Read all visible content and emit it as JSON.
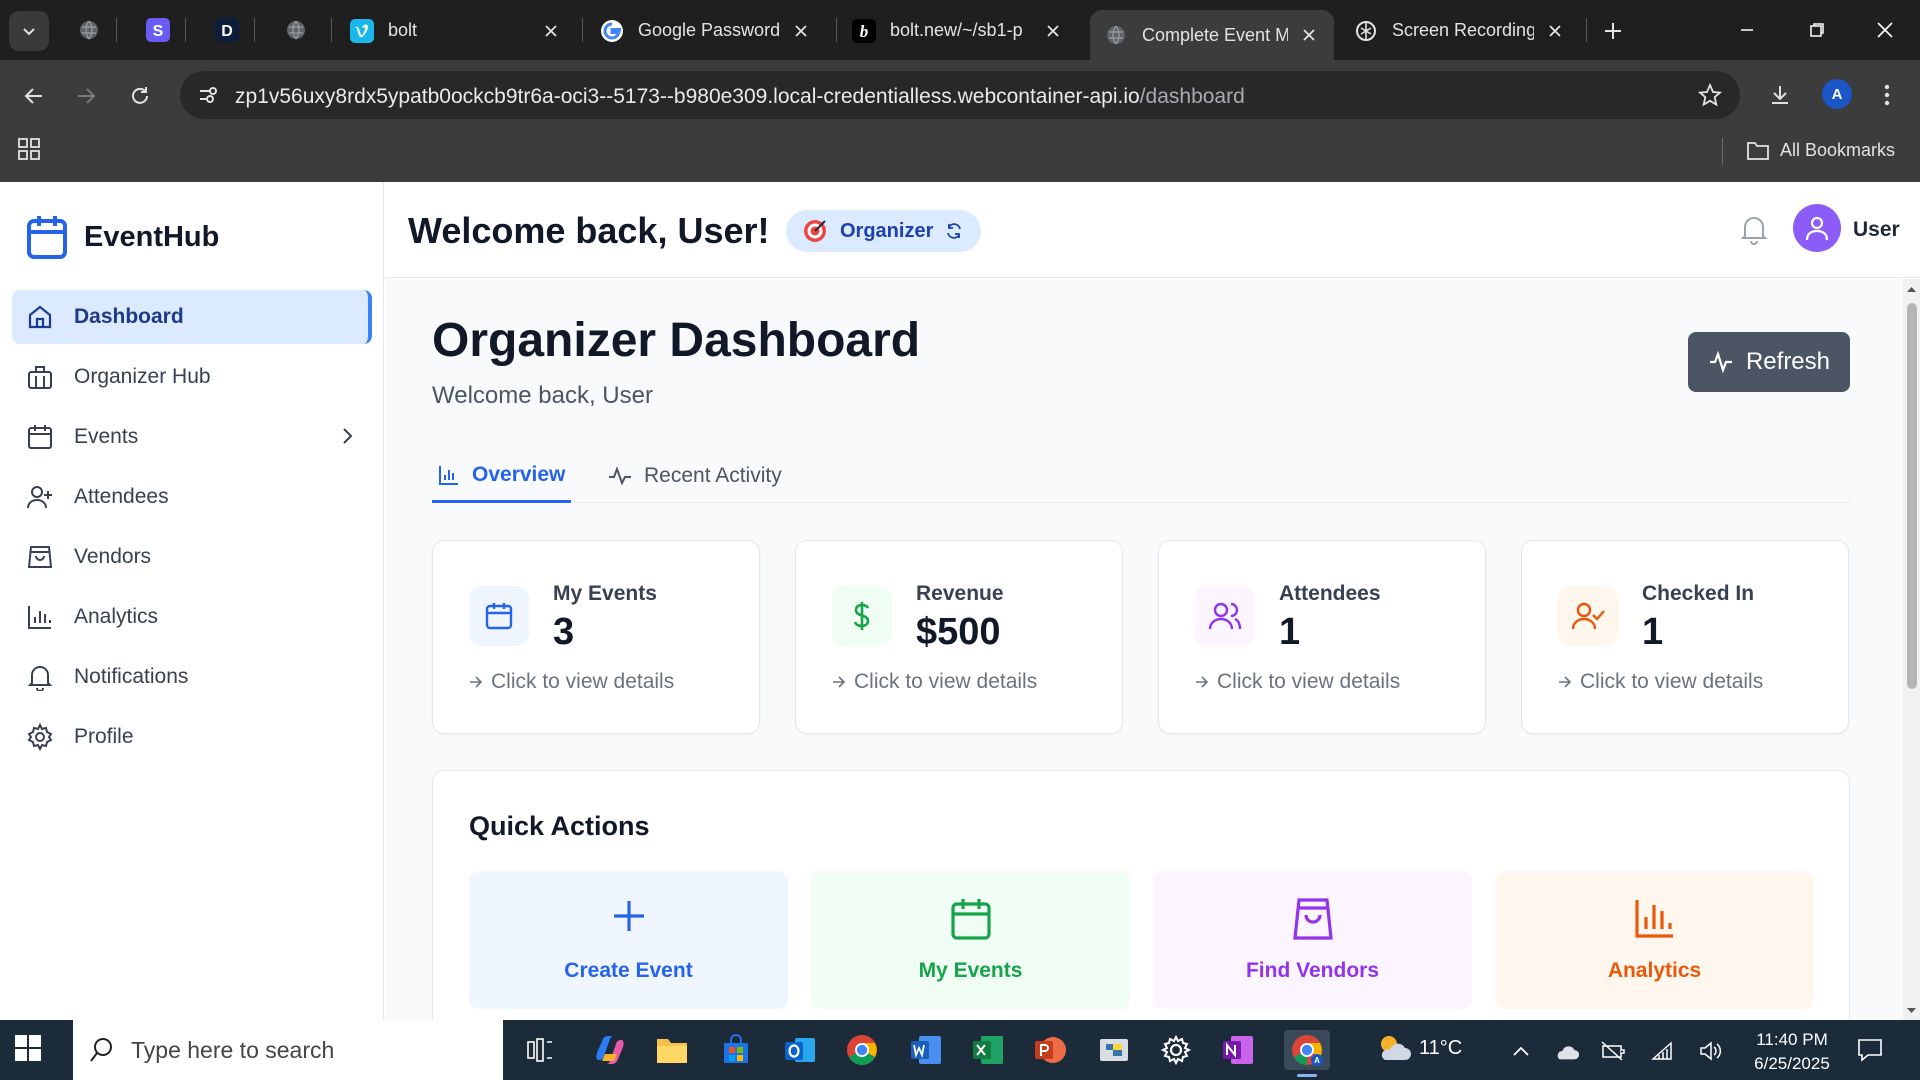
{
  "browser": {
    "tabs": [
      {
        "title": "bolt",
        "favicon": "bolt-favicon"
      },
      {
        "title": "Google Password M",
        "favicon": "google-favicon"
      },
      {
        "title": "bolt.new/~/sb1-p",
        "favicon": "bolt-new-favicon"
      },
      {
        "title": "Complete Event M",
        "favicon": "globe-favicon",
        "active": true
      },
      {
        "title": "Screen Recording",
        "favicon": "openai-favicon"
      }
    ],
    "url_host": "zp1v56uxy8rdx5ypatb0ockcb9tr6a-oci3--5173--b980e309.local-credentialless.webcontainer-api.io",
    "url_path": "/dashboard",
    "profile_initial": "A",
    "bookmarks_label": "All Bookmarks"
  },
  "sidebar": {
    "brand": "EventHub",
    "items": [
      {
        "label": "Dashboard",
        "icon": "home-icon",
        "active": true
      },
      {
        "label": "Organizer Hub",
        "icon": "building-icon"
      },
      {
        "label": "Events",
        "icon": "calendar-icon",
        "has_submenu": true
      },
      {
        "label": "Attendees",
        "icon": "user-plus-icon"
      },
      {
        "label": "Vendors",
        "icon": "shopping-bag-icon"
      },
      {
        "label": "Analytics",
        "icon": "bar-chart-icon"
      },
      {
        "label": "Notifications",
        "icon": "bell-icon"
      },
      {
        "label": "Profile",
        "icon": "gear-icon"
      }
    ]
  },
  "header": {
    "welcome": "Welcome back, User!",
    "role_emoji": "🎯",
    "role": "Organizer",
    "user_name": "User"
  },
  "dashboard": {
    "title": "Organizer Dashboard",
    "subtitle": "Welcome back, User",
    "refresh_label": "Refresh",
    "tabs": [
      {
        "label": "Overview",
        "active": true
      },
      {
        "label": "Recent Activity"
      }
    ],
    "stats": [
      {
        "label": "My Events",
        "value": "3",
        "link": "Click to view details",
        "color": "#2563eb"
      },
      {
        "label": "Revenue",
        "value": "$500",
        "link": "Click to view details",
        "color": "#16a34a"
      },
      {
        "label": "Attendees",
        "value": "1",
        "link": "Click to view details",
        "color": "#9333ea"
      },
      {
        "label": "Checked In",
        "value": "1",
        "link": "Click to view details",
        "color": "#ea580c"
      }
    ],
    "quick_actions_title": "Quick Actions",
    "quick_actions": [
      {
        "label": "Create Event",
        "color": "#2563eb"
      },
      {
        "label": "My Events",
        "color": "#16a34a"
      },
      {
        "label": "Find Vendors",
        "color": "#9333ea"
      },
      {
        "label": "Analytics",
        "color": "#ea580c"
      }
    ]
  },
  "taskbar": {
    "search_placeholder": "Type here to search",
    "temperature": "11°C",
    "time": "11:40 PM",
    "date": "6/25/2025"
  }
}
